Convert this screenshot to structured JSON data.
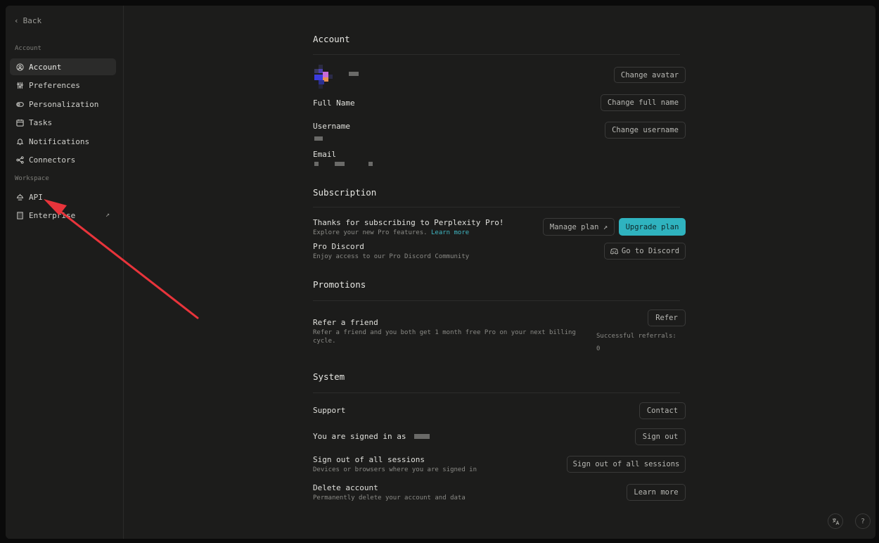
{
  "sidebar": {
    "back_label": "Back",
    "account_section": "Account",
    "workspace_section": "Workspace",
    "items": [
      {
        "label": "Account",
        "icon": "user-circle-icon"
      },
      {
        "label": "Preferences",
        "icon": "sliders-icon"
      },
      {
        "label": "Personalization",
        "icon": "toggle-icon"
      },
      {
        "label": "Tasks",
        "icon": "calendar-icon"
      },
      {
        "label": "Notifications",
        "icon": "bell-icon"
      },
      {
        "label": "Connectors",
        "icon": "share-icon"
      }
    ],
    "workspace_items": [
      {
        "label": "API",
        "icon": "api-icon"
      },
      {
        "label": "Enterprise",
        "icon": "building-icon",
        "external": "↗"
      }
    ]
  },
  "account": {
    "title": "Account",
    "change_avatar": "Change avatar",
    "full_name_label": "Full Name",
    "change_full_name": "Change full name",
    "username_label": "Username",
    "change_username": "Change username",
    "email_label": "Email"
  },
  "subscription": {
    "title": "Subscription",
    "thanks": "Thanks for subscribing to Perplexity Pro!",
    "explore": "Explore your new Pro features.",
    "learn_more": "Learn more",
    "manage_plan": "Manage plan ↗",
    "upgrade_plan": "Upgrade plan",
    "discord_label": "Pro Discord",
    "discord_sub": "Enjoy access to our Pro Discord Community",
    "go_discord": "Go to Discord"
  },
  "promotions": {
    "title": "Promotions",
    "refer_label": "Refer a friend",
    "refer_sub": "Refer a friend and you both get 1 month free Pro on your next billing cycle.",
    "refer_button": "Refer",
    "referrals_label": "Successful referrals:",
    "referrals_count": "0"
  },
  "system": {
    "title": "System",
    "support_label": "Support",
    "contact": "Contact",
    "signed_in_label": "You are signed in as",
    "sign_out": "Sign out",
    "all_sessions_label": "Sign out of all sessions",
    "all_sessions_sub": "Devices or browsers where you are signed in",
    "all_sessions_button": "Sign out of all sessions",
    "delete_label": "Delete account",
    "delete_sub": "Permanently delete your account and data",
    "delete_button": "Learn more"
  },
  "corner": {
    "language_icon": "translate-icon",
    "help_label": "?"
  },
  "colors": {
    "accent": "#2fb3bf",
    "background": "#1c1c1b",
    "annotation_arrow": "#e8343b"
  }
}
